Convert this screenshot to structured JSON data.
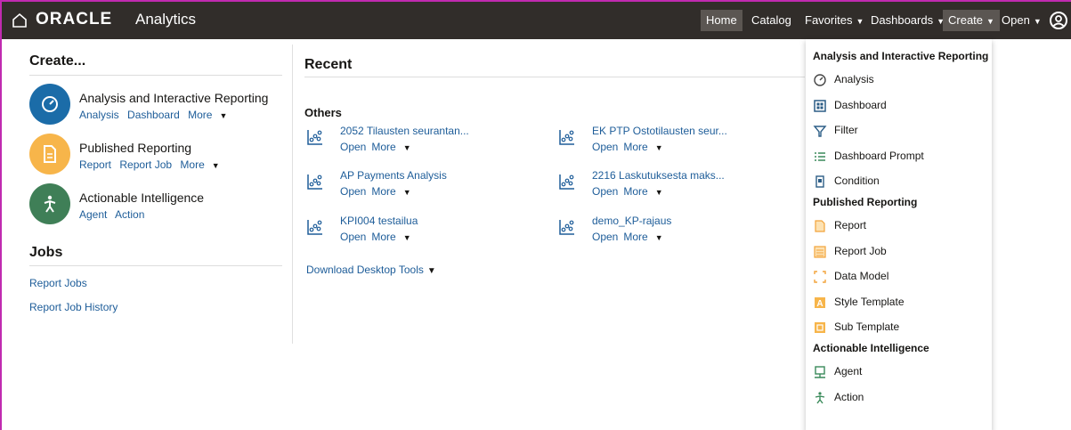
{
  "topbar": {
    "brand": "ORACLE",
    "brand_sub": "Analytics",
    "nav": {
      "home": "Home",
      "catalog": "Catalog",
      "favorites": "Favorites",
      "dashboards": "Dashboards",
      "create": "Create",
      "open": "Open"
    }
  },
  "create_panel": {
    "title": "Create...",
    "items": [
      {
        "title": "Analysis and Interactive Reporting",
        "links": [
          "Analysis",
          "Dashboard",
          "More"
        ],
        "color": "#1b6ca8",
        "icon": "gauge-icon"
      },
      {
        "title": "Published Reporting",
        "links": [
          "Report",
          "Report Job",
          "More"
        ],
        "color": "#f7b54a",
        "icon": "document-icon"
      },
      {
        "title": "Actionable Intelligence",
        "links": [
          "Agent",
          "Action"
        ],
        "color": "#3f7f57",
        "icon": "runner-icon"
      }
    ]
  },
  "jobs": {
    "title": "Jobs",
    "links": [
      "Report Jobs",
      "Report Job History"
    ]
  },
  "recent": {
    "title": "Recent",
    "group_title": "Others",
    "items": [
      {
        "name": "2052 Tilausten seurantan...",
        "open": "Open",
        "more": "More"
      },
      {
        "name": "EK PTP Ostotilausten seur...",
        "open": "Open",
        "more": "More"
      },
      {
        "name": "AP Payments Analysis",
        "open": "Open",
        "more": "More"
      },
      {
        "name": "2216 Laskutuksesta maks...",
        "open": "Open",
        "more": "More"
      },
      {
        "name": "KPI004 testailua",
        "open": "Open",
        "more": "More"
      },
      {
        "name": "demo_KP-rajaus",
        "open": "Open",
        "more": "More"
      }
    ],
    "download": "Download Desktop Tools"
  },
  "create_menu": {
    "sections": [
      {
        "heading": "Analysis and Interactive Reporting",
        "items": [
          {
            "label": "Analysis",
            "icon": "analysis-icon"
          },
          {
            "label": "Dashboard",
            "icon": "dashboard-icon"
          },
          {
            "label": "Filter",
            "icon": "filter-icon"
          },
          {
            "label": "Dashboard Prompt",
            "icon": "prompt-icon"
          },
          {
            "label": "Condition",
            "icon": "condition-icon"
          }
        ]
      },
      {
        "heading": "Published Reporting",
        "items": [
          {
            "label": "Report",
            "icon": "report-icon"
          },
          {
            "label": "Report Job",
            "icon": "report-job-icon"
          },
          {
            "label": "Data Model",
            "icon": "data-model-icon"
          },
          {
            "label": "Style Template",
            "icon": "style-template-icon"
          },
          {
            "label": "Sub Template",
            "icon": "sub-template-icon"
          }
        ]
      },
      {
        "heading": "Actionable Intelligence",
        "items": [
          {
            "label": "Agent",
            "icon": "agent-icon"
          },
          {
            "label": "Action",
            "icon": "action-icon"
          }
        ]
      }
    ]
  },
  "colors": {
    "topbar": "#312d2a",
    "link": "#1e5d99",
    "frame": "#c02ab0",
    "accent_orange": "#f7b54a"
  }
}
